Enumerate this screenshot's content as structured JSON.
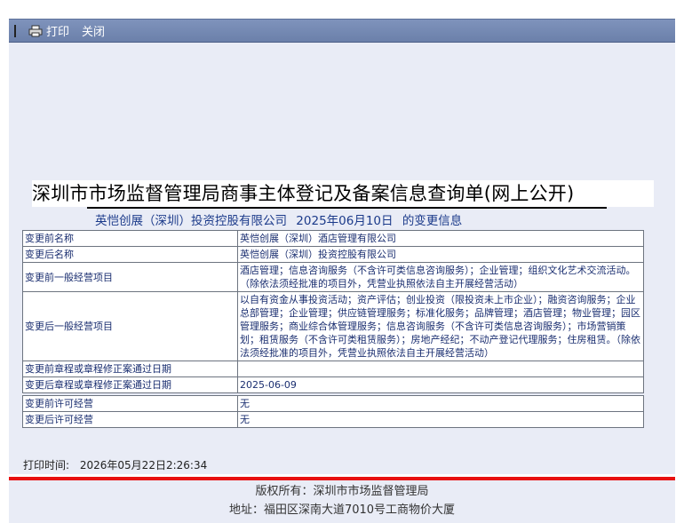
{
  "toolbar": {
    "print_label": "打印",
    "close_label": "关闭"
  },
  "document": {
    "title": "深圳市市场监督管理局商事主体登记及备案信息查询单(网上公开)",
    "subtitle": {
      "company": "英恺创展（深圳）投资控股有限公司",
      "date": "2025年06月10日",
      "suffix": "的变更信息"
    },
    "rows": [
      {
        "label": "变更前名称",
        "value": "英恺创展（深圳）酒店管理有限公司"
      },
      {
        "label": "变更后名称",
        "value": "英恺创展（深圳）投资控股有限公司"
      },
      {
        "label": "变更前一般经营项目",
        "value": "酒店管理；信息咨询服务（不含许可类信息咨询服务）；企业管理；组织文化艺术交流活动。（除依法须经批准的项目外，凭营业执照依法自主开展经营活动）"
      },
      {
        "label": "变更后一般经营项目",
        "value": "以自有资金从事投资活动；资产评估；创业投资（限投资未上市企业）；融资咨询服务；企业总部管理；企业管理；供应链管理服务；标准化服务；品牌管理；酒店管理；物业管理；园区管理服务；商业综合体管理服务；信息咨询服务（不含许可类信息咨询服务）；市场营销策划；租赁服务（不含许可类租赁服务）；房地产经纪；不动产登记代理服务；住房租赁。（除依法须经批准的项目外，凭营业执照依法自主开展经营活动）"
      },
      {
        "label": "变更前章程或章程修正案通过日期",
        "value": ""
      },
      {
        "label": "变更后章程或章程修正案通过日期",
        "value": "2025-06-09"
      },
      {
        "label": "变更前许可经营",
        "value": "无"
      },
      {
        "label": "变更后许可经营",
        "value": "无"
      }
    ],
    "print_time_label": "打印时间:",
    "print_time_value": "2026年05月22日2:26:34"
  },
  "footer": {
    "copyright": "版权所有：深圳市市场监督管理局",
    "address": "地址：福田区深南大道7010号工商物价大厦"
  },
  "colors": {
    "toolbar": "#7385b0",
    "background": "#e9ecf6",
    "table_text": "#1a2e70",
    "subtitle_text": "#1b3a8a",
    "accent_line": "#e81010"
  },
  "icons": {
    "print": "printer-icon"
  }
}
